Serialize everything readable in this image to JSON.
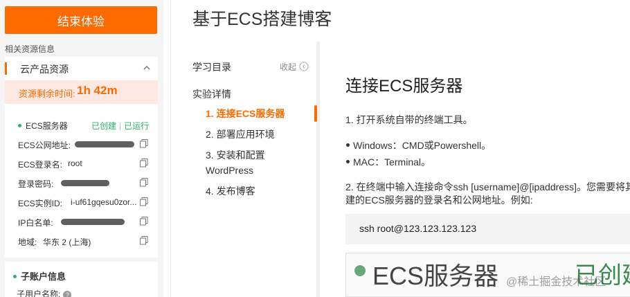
{
  "sidebar": {
    "end_button": "结束体验",
    "section_label": "相关资源信息",
    "product": {
      "title": "云产品资源",
      "timer_label": "资源剩余时间:",
      "timer_value": "1h 42m",
      "ecs_label": "ECS服务器",
      "status_created": "已创建",
      "status_sep": "|",
      "status_running": "已运行",
      "rows": [
        {
          "label": "ECS公网地址:",
          "value": ""
        },
        {
          "label": "ECS登录名:",
          "value": "root"
        },
        {
          "label": "登录密码:",
          "value": ""
        },
        {
          "label": "ECS实例ID:",
          "value": "i-uf61gqesu0zor..."
        },
        {
          "label": "IP白名单:",
          "value": ""
        },
        {
          "label": "地域:",
          "value": "华东 2 (上海)"
        }
      ]
    },
    "sub_account": {
      "title": "子账户信息",
      "username_label": "子用户名称:"
    }
  },
  "page": {
    "title": "基于ECS搭建博客"
  },
  "toc": {
    "heading": "学习目录",
    "collapse": "收起",
    "section": "实验详情",
    "items": [
      {
        "label": "1. 连接ECS服务器"
      },
      {
        "label": "2. 部署应用环境"
      },
      {
        "label": "3. 安装和配置 WordPress"
      },
      {
        "label": "4. 发布博客"
      }
    ]
  },
  "content": {
    "heading": "连接ECS服务器",
    "step1": "1.  打开系统自带的终端工具。",
    "bullets": [
      "Windows：CMD或Powershell。",
      "MAC：Terminal。"
    ],
    "step2_line1": "2.  在终端中输入连接命令ssh [username]@[ipaddress]。您需要将其",
    "step2_line2": "建的ECS服务器的登录名和公网地址。例如:",
    "code": "ssh root@123.123.123.123",
    "image_text": "ECS服务器",
    "image_status": "已创建"
  },
  "watermark": "@稀土掘金技术社区",
  "colors": {
    "accent": "#ff6a00",
    "success": "#2bb36d"
  }
}
